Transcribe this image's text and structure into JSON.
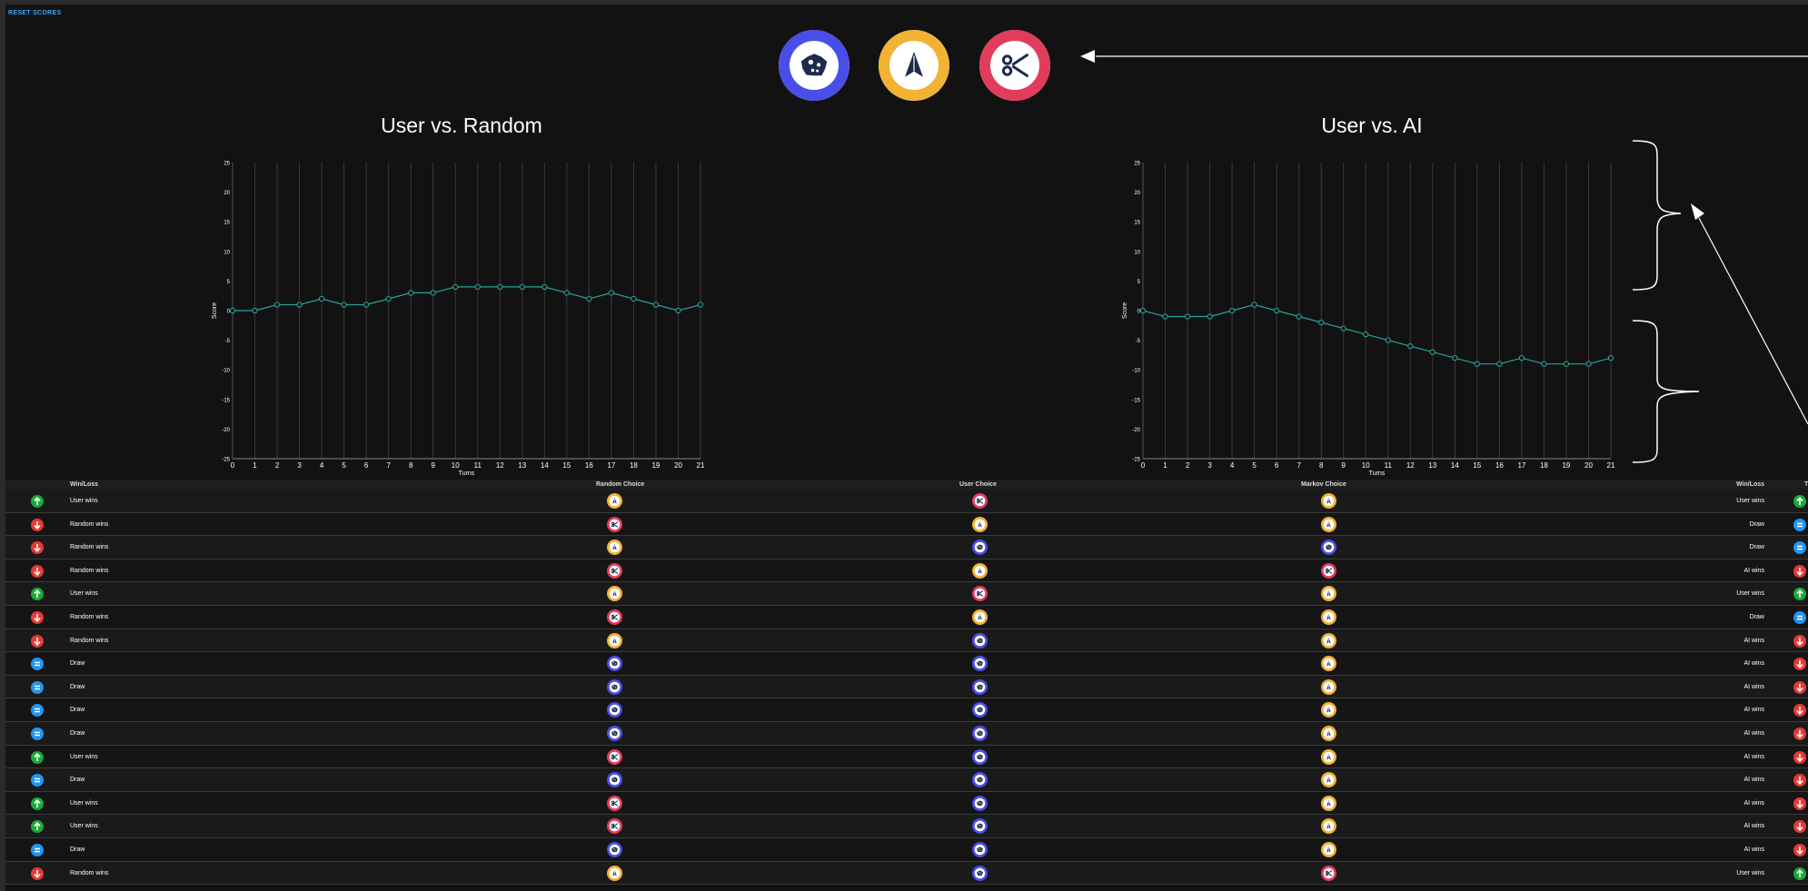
{
  "header": {
    "reset_label": "RESET SCORES"
  },
  "choices": [
    {
      "name": "rock",
      "icon": "rock-icon",
      "color": "#4a4ee8"
    },
    {
      "name": "paper",
      "icon": "paper-plane-icon",
      "color": "#f2b233"
    },
    {
      "name": "scissors",
      "icon": "scissors-icon",
      "color": "#e23c5d"
    }
  ],
  "colors": {
    "win": "#1aa83a",
    "loss": "#e53935",
    "draw": "#2196f3",
    "line": "#2aa198"
  },
  "chart_data": [
    {
      "type": "line",
      "title": "User vs. Random",
      "xlabel": "Turns",
      "ylabel": "Score",
      "ylim": [
        -25,
        25
      ],
      "y_ticks": [
        -25,
        -20,
        -15,
        -10,
        -5,
        0,
        5,
        10,
        15,
        20,
        25
      ],
      "x": [
        0,
        1,
        2,
        3,
        4,
        5,
        6,
        7,
        8,
        9,
        10,
        11,
        12,
        13,
        14,
        15,
        16,
        17,
        18,
        19,
        20,
        21
      ],
      "values": [
        0,
        0,
        1,
        1,
        2,
        1,
        1,
        2,
        3,
        3,
        4,
        4,
        4,
        4,
        4,
        3,
        2,
        3,
        2,
        1,
        0,
        1
      ]
    },
    {
      "type": "line",
      "title": "User vs. AI",
      "xlabel": "Turns",
      "ylabel": "Score",
      "ylim": [
        -25,
        25
      ],
      "y_ticks": [
        -25,
        -20,
        -15,
        -10,
        -5,
        0,
        5,
        10,
        15,
        20,
        25
      ],
      "x": [
        0,
        1,
        2,
        3,
        4,
        5,
        6,
        7,
        8,
        9,
        10,
        11,
        12,
        13,
        14,
        15,
        16,
        17,
        18,
        19,
        20,
        21
      ],
      "values": [
        0,
        -1,
        -1,
        -1,
        0,
        1,
        0,
        -1,
        -2,
        -3,
        -4,
        -5,
        -6,
        -7,
        -8,
        -9,
        -9,
        -8,
        -9,
        -9,
        -9,
        -8
      ]
    }
  ],
  "table": {
    "headers": {
      "winloss_left": "Win/Loss",
      "random_choice": "Random Choice",
      "user_choice": "User Choice",
      "markov_choice": "Markov Choice",
      "winloss_right": "Win/Loss",
      "cut_header": "T"
    },
    "rows": [
      {
        "left_result": "win",
        "left_text": "User wins",
        "random": "paper",
        "user": "scissors",
        "markov": "paper",
        "right_text": "User wins",
        "right_result": "win"
      },
      {
        "left_result": "loss",
        "left_text": "Random wins",
        "random": "scissors",
        "user": "paper",
        "markov": "paper",
        "right_text": "Draw",
        "right_result": "draw"
      },
      {
        "left_result": "loss",
        "left_text": "Random wins",
        "random": "paper",
        "user": "rock",
        "markov": "rock",
        "right_text": "Draw",
        "right_result": "draw"
      },
      {
        "left_result": "loss",
        "left_text": "Random wins",
        "random": "scissors",
        "user": "paper",
        "markov": "scissors",
        "right_text": "AI wins",
        "right_result": "loss"
      },
      {
        "left_result": "win",
        "left_text": "User wins",
        "random": "paper",
        "user": "scissors",
        "markov": "paper",
        "right_text": "User wins",
        "right_result": "win"
      },
      {
        "left_result": "loss",
        "left_text": "Random wins",
        "random": "scissors",
        "user": "paper",
        "markov": "paper",
        "right_text": "Draw",
        "right_result": "draw"
      },
      {
        "left_result": "loss",
        "left_text": "Random wins",
        "random": "paper",
        "user": "rock",
        "markov": "paper",
        "right_text": "AI wins",
        "right_result": "loss"
      },
      {
        "left_result": "draw",
        "left_text": "Draw",
        "random": "rock",
        "user": "rock",
        "markov": "paper",
        "right_text": "AI wins",
        "right_result": "loss"
      },
      {
        "left_result": "draw",
        "left_text": "Draw",
        "random": "rock",
        "user": "rock",
        "markov": "paper",
        "right_text": "AI wins",
        "right_result": "loss"
      },
      {
        "left_result": "draw",
        "left_text": "Draw",
        "random": "rock",
        "user": "rock",
        "markov": "paper",
        "right_text": "AI wins",
        "right_result": "loss"
      },
      {
        "left_result": "draw",
        "left_text": "Draw",
        "random": "rock",
        "user": "rock",
        "markov": "paper",
        "right_text": "AI wins",
        "right_result": "loss"
      },
      {
        "left_result": "win",
        "left_text": "User wins",
        "random": "scissors",
        "user": "rock",
        "markov": "paper",
        "right_text": "AI wins",
        "right_result": "loss"
      },
      {
        "left_result": "draw",
        "left_text": "Draw",
        "random": "rock",
        "user": "rock",
        "markov": "paper",
        "right_text": "AI wins",
        "right_result": "loss"
      },
      {
        "left_result": "win",
        "left_text": "User wins",
        "random": "scissors",
        "user": "rock",
        "markov": "paper",
        "right_text": "AI wins",
        "right_result": "loss"
      },
      {
        "left_result": "win",
        "left_text": "User wins",
        "random": "scissors",
        "user": "rock",
        "markov": "paper",
        "right_text": "AI wins",
        "right_result": "loss"
      },
      {
        "left_result": "draw",
        "left_text": "Draw",
        "random": "rock",
        "user": "rock",
        "markov": "paper",
        "right_text": "AI wins",
        "right_result": "loss"
      },
      {
        "left_result": "loss",
        "left_text": "Random wins",
        "random": "paper",
        "user": "rock",
        "markov": "scissors",
        "right_text": "User wins",
        "right_result": "win"
      }
    ]
  }
}
